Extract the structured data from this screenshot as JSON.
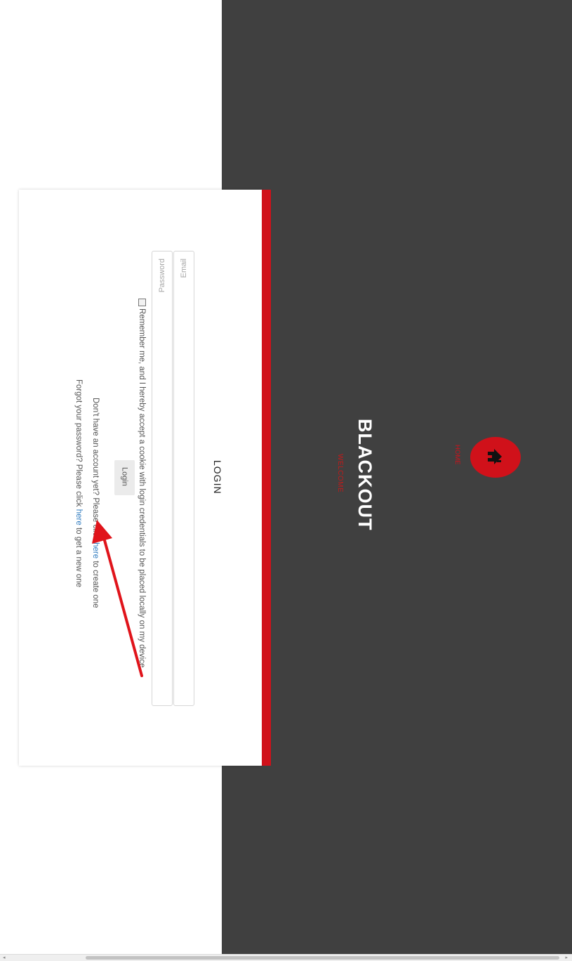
{
  "header": {
    "brand": "BLACKOUT",
    "welcome": "WELCOME",
    "home_label": "HOME",
    "accent_color": "#d0111a",
    "background_color": "#404040"
  },
  "login": {
    "title": "LOGIN",
    "email_placeholder": "Email",
    "password_placeholder": "Password",
    "remember_text": "Remember me, and I hereby accept a cookie with login credentials to be placed locally on my device",
    "button_label": "Login",
    "signup": {
      "prefix": "Don't have an account yet? Please click ",
      "link": "here",
      "suffix": " to create one"
    },
    "forgot": {
      "prefix": "Forgot your password? Please click ",
      "link": "here",
      "suffix": " to get a new one"
    }
  },
  "scrollbar": {
    "left_arrow": "◂",
    "right_arrow": "▸"
  }
}
